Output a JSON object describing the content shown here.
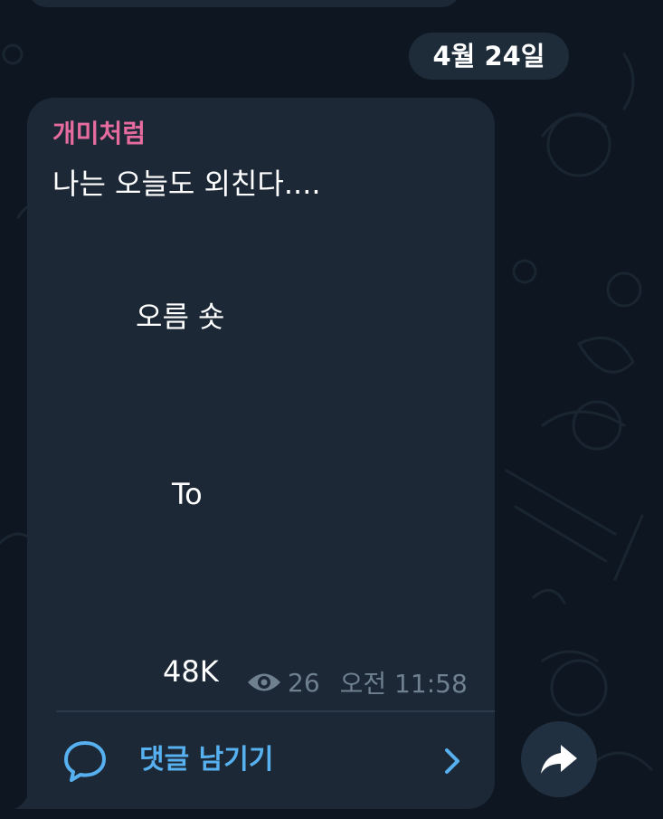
{
  "date_separator": "4월 24일",
  "message": {
    "sender": "개미처럼",
    "lines": [
      "나는 오늘도 외친다....",
      "오름 숏",
      "To",
      "48K"
    ],
    "views": "26",
    "time": "오전 11:58"
  },
  "comments": {
    "label": "댓글 남기기"
  },
  "icons": {
    "views": "eye-icon",
    "comment": "speech-bubble-icon",
    "open_comments": "chevron-right-icon",
    "share": "share-arrow-icon"
  },
  "colors": {
    "background": "#0e1621",
    "bubble": "#1c2836",
    "sender_name": "#e66b9e",
    "accent": "#57b0ef",
    "meta_text": "#6f808f"
  }
}
